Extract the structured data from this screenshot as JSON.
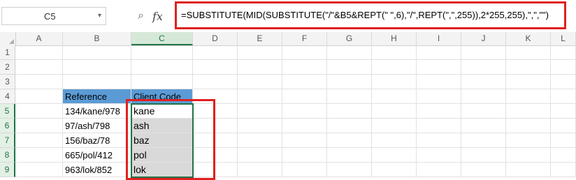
{
  "name_box": {
    "value": "C5"
  },
  "formula_bar": {
    "formula": "=SUBSTITUTE(MID(SUBSTITUTE(\"/\"&B5&REPT(\" \",6),\"/\",REPT(\",\",255)),2*255,255),\",\",\"\")"
  },
  "icons": {
    "zoom": "zoom-icon",
    "fx": "fx-icon"
  },
  "columns": [
    "A",
    "B",
    "C",
    "D",
    "E",
    "F",
    "G",
    "H",
    "I",
    "J",
    "K",
    "L"
  ],
  "rows": [
    "1",
    "2",
    "3",
    "4",
    "5",
    "6",
    "7",
    "8",
    "9"
  ],
  "table": {
    "headers": [
      "Reference",
      "Client Code"
    ],
    "rows": [
      [
        "134/kane/978",
        "kane"
      ],
      [
        "97/ash/798",
        "ash"
      ],
      [
        "156/baz/78",
        "baz"
      ],
      [
        "665/pol/412",
        "pol"
      ],
      [
        "963/lok/852",
        "lok"
      ]
    ]
  },
  "colors": {
    "header_fill": "#5b9bd5",
    "selection": "#217346",
    "highlight": "#e02020",
    "selected_fill": "#d9d9d9"
  }
}
